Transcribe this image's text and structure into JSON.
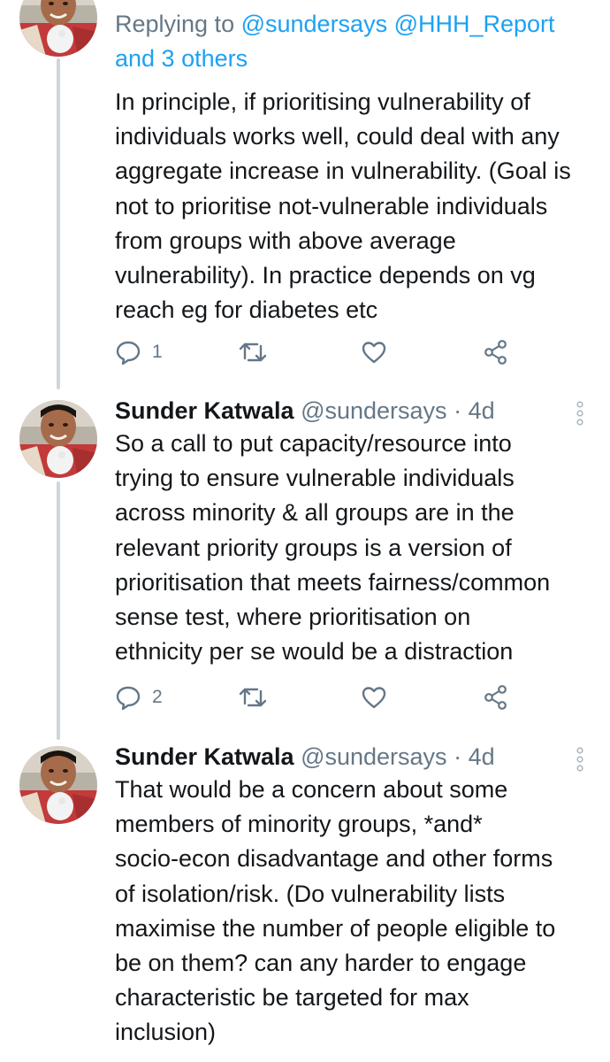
{
  "tweets": [
    {
      "reply_prefix": "Replying to ",
      "reply_mentions": "@sundersays @HHH_Report",
      "reply_others": "and 3 others",
      "body_lines": [
        "In principle, if prioritising vulnerability of",
        "individuals works well, could deal with any",
        "aggregate increase in vulnerability. (Goal is",
        "not to prioritise not-vulnerable individuals",
        "from groups with above average",
        "vulnerability). In practice depends on vg",
        "reach eg for diabetes etc"
      ],
      "reply_count": "1"
    },
    {
      "name": "Sunder Katwala",
      "handle": "@sundersays",
      "separator": " · ",
      "time": "4d",
      "body_lines": [
        "So a call to put capacity/resource into",
        "trying to ensure vulnerable individuals",
        "across minority & all groups are in the",
        "relevant priority groups is a version of",
        "prioritisation that meets fairness/common",
        "sense test, where prioritisation on",
        "ethnicity per se would be a distraction"
      ],
      "reply_count": "2"
    },
    {
      "name": "Sunder Katwala",
      "handle": "@sundersays",
      "separator": " · ",
      "time": "4d",
      "body_lines": [
        "That would be a concern about some",
        "members of minority groups, *and*",
        "socio-econ disadvantage and other forms",
        "of isolation/risk. (Do vulnerability lists",
        "maximise the number of people eligible to",
        "be on them? can any harder to engage",
        "characteristic be targeted for max",
        "inclusion)"
      ]
    }
  ],
  "colors": {
    "text": "#14171a",
    "secondary": "#657786",
    "link": "#1da1f2",
    "thread_line": "#ccd6dd"
  },
  "icons": [
    "reply-icon",
    "retweet-icon",
    "like-icon",
    "share-icon",
    "more-icon"
  ]
}
